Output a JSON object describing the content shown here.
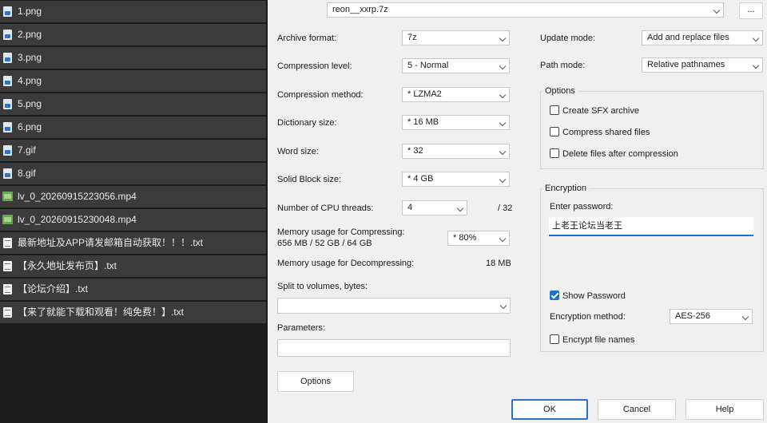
{
  "files": [
    {
      "name": "1.png",
      "type": "image"
    },
    {
      "name": "2.png",
      "type": "image"
    },
    {
      "name": "3.png",
      "type": "image"
    },
    {
      "name": "4.png",
      "type": "image"
    },
    {
      "name": "5.png",
      "type": "image"
    },
    {
      "name": "6.png",
      "type": "image"
    },
    {
      "name": "7.gif",
      "type": "image"
    },
    {
      "name": "8.gif",
      "type": "image"
    },
    {
      "name": "lv_0_20260915223056.mp4",
      "type": "video"
    },
    {
      "name": "lv_0_20260915230048.mp4",
      "type": "video"
    },
    {
      "name": "最新地址及APP请发邮箱自动获取！！！.txt",
      "type": "text"
    },
    {
      "name": "【永久地址发布页】.txt",
      "type": "text"
    },
    {
      "name": "【论坛介绍】.txt",
      "type": "text"
    },
    {
      "name": "【来了就能下载和观看！纯免费！】.txt",
      "type": "text"
    }
  ],
  "archive": {
    "name_value": "reon__xxrp.7z",
    "browse_label": "..."
  },
  "settings": {
    "archive_format_label": "Archive format:",
    "archive_format_value": "7z",
    "compression_level_label": "Compression level:",
    "compression_level_value": "5 - Normal",
    "compression_method_label": "Compression method:",
    "compression_method_value": "* LZMA2",
    "dictionary_size_label": "Dictionary size:",
    "dictionary_size_value": "* 16 MB",
    "word_size_label": "Word size:",
    "word_size_value": "* 32",
    "solid_block_label": "Solid Block size:",
    "solid_block_value": "* 4 GB",
    "cpu_threads_label": "Number of CPU threads:",
    "cpu_threads_value": "4",
    "cpu_threads_total": "/ 32",
    "mem_compress_label_1": "Memory usage for Compressing:",
    "mem_compress_label_2": "656 MB / 52 GB / 64 GB",
    "mem_compress_value": "* 80%",
    "mem_decompress_label": "Memory usage for Decompressing:",
    "mem_decompress_value": "18 MB",
    "split_label": "Split to volumes, bytes:",
    "split_value": "",
    "parameters_label": "Parameters:",
    "parameters_value": "",
    "options_button": "Options"
  },
  "right": {
    "update_mode_label": "Update mode:",
    "update_mode_value": "Add and replace files",
    "path_mode_label": "Path mode:",
    "path_mode_value": "Relative pathnames",
    "options_group": "Options",
    "create_sfx": "Create SFX archive",
    "compress_shared": "Compress shared files",
    "delete_after": "Delete files after compression",
    "encryption_group": "Encryption",
    "enter_password_label": "Enter password:",
    "password_value": "上老王论坛当老王",
    "show_password": "Show Password",
    "encryption_method_label": "Encryption method:",
    "encryption_method_value": "AES-256",
    "encrypt_names": "Encrypt file names"
  },
  "buttons": {
    "ok": "OK",
    "cancel": "Cancel",
    "help": "Help"
  },
  "colors": {
    "accent": "#1a73c8",
    "file_row_bg": "#3b3b3b",
    "dialog_bg": "#f0f0f0"
  }
}
